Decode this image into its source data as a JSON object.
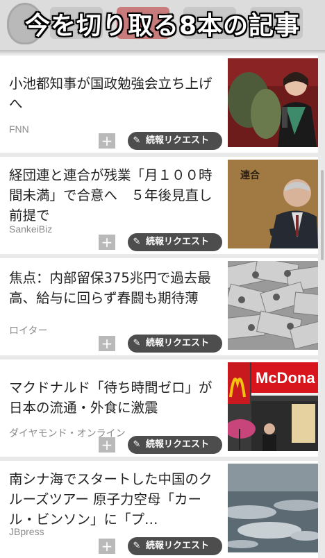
{
  "header": {
    "title": "今を切り取る8本の記事"
  },
  "articles": [
    {
      "title": "小池都知事が国政勉強会立ち上げへ",
      "source": "FNN",
      "add_label": "+",
      "request_label": "続報リクエスト"
    },
    {
      "title": "経団連と連合が残業「月１００時間未満」で合意へ　５年後見直し前提で",
      "source": "SankeiBiz",
      "add_label": "+",
      "request_label": "続報リクエスト",
      "thumb_text": "連合"
    },
    {
      "title": "焦点：内部留保375兆円で過去最高、給与に回らず春闘も期待薄",
      "source": "ロイター",
      "add_label": "+",
      "request_label": "続報リクエスト"
    },
    {
      "title": "マクドナルド「待ち時間ゼロ」が日本の流通・外食に激震",
      "source": "ダイヤモンド・オンライン",
      "add_label": "+",
      "request_label": "続報リクエスト",
      "thumb_text": "McDona"
    },
    {
      "title": "南シナ海でスタートした中国のクルーズツアー 原子力空母「カール・ビンソン」に「プ…",
      "source": "JBpress",
      "add_label": "+",
      "request_label": "続報リクエスト"
    }
  ],
  "colors": {
    "background": "#e9e9e9",
    "card": "#ffffff",
    "button_dark": "#4d4d4d",
    "active_tab": "#c97c7c"
  }
}
